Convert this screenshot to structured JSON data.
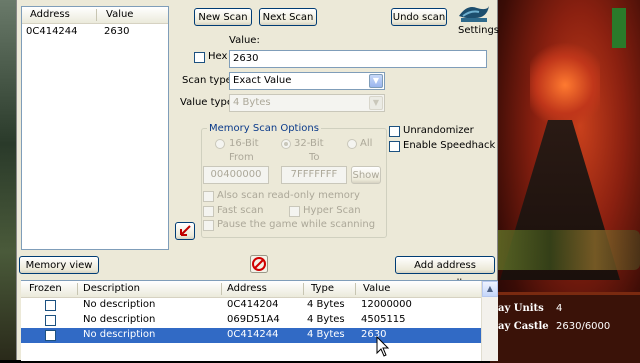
{
  "found_list": {
    "col_address": "Address",
    "col_value": "Value",
    "rows": [
      {
        "address": "0C414244",
        "value": "2630"
      }
    ]
  },
  "toolbar": {
    "new_scan": "New Scan",
    "next_scan": "Next Scan",
    "undo_scan": "Undo scan",
    "settings": "Settings"
  },
  "scan": {
    "value_label": "Value:",
    "hex_label": "Hex",
    "value": "2630",
    "scan_type_label": "Scan type",
    "scan_type": "Exact Value",
    "value_type_label": "Value type",
    "value_type": "4 Bytes"
  },
  "memory_options": {
    "title": "Memory Scan Options",
    "bit16": "16-Bit",
    "bit32": "32-Bit",
    "all": "All",
    "from_label": "From",
    "to_label": "To",
    "from": "00400000",
    "to": "7FFFFFFF",
    "show": "Show",
    "readonly": "Also scan read-only memory",
    "fast_scan": "Fast scan",
    "hyper_scan": "Hyper Scan",
    "pause": "Pause the game while scanning"
  },
  "checks": {
    "unrandomizer": "Unrandomizer",
    "speedhack": "Enable Speedhack"
  },
  "buttons": {
    "memory_view": "Memory view",
    "add_manually": "Add address manually"
  },
  "table": {
    "headers": {
      "frozen": "Frozen",
      "description": "Description",
      "address": "Address",
      "type": "Type",
      "value": "Value"
    },
    "rows": [
      {
        "description": "No description",
        "address": "0C414204",
        "type": "4 Bytes",
        "value": "12000000",
        "selected": false
      },
      {
        "description": "No description",
        "address": "069D51A4",
        "type": "4 Bytes",
        "value": "4505115",
        "selected": false
      },
      {
        "description": "No description",
        "address": "0C414244",
        "type": "4 Bytes",
        "value": "2630",
        "selected": true
      }
    ]
  },
  "game": {
    "units_label": "ay Units",
    "units_value": "4",
    "castle_label": "ay Castle",
    "castle_value": "2630/6000"
  },
  "colors": {
    "selection": "#316ac5",
    "window": "#ece9d8",
    "link_blue": "#0a3a8a"
  },
  "icons": [
    "cheat-engine-logo-icon",
    "pointer-arrow-icon",
    "stop-icon",
    "combo-arrow-icon",
    "scroll-up-icon",
    "mouse-cursor-icon"
  ]
}
